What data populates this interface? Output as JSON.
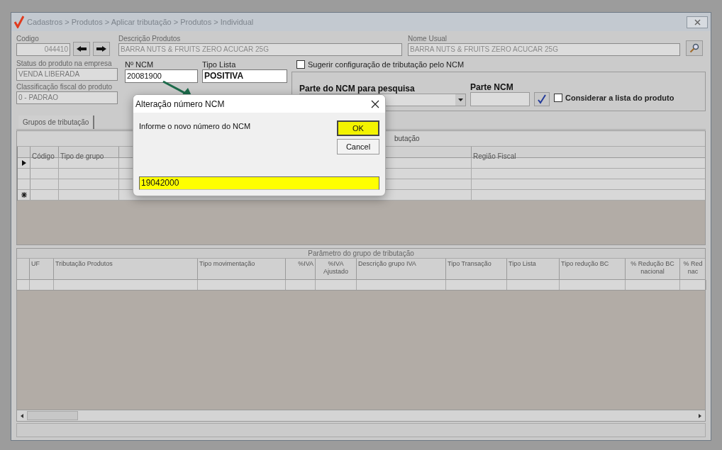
{
  "window": {
    "title": "Cadastros > Produtos > Aplicar tributação > Produtos > Individual"
  },
  "product": {
    "code_label": "Codigo",
    "code": "044410",
    "description_label": "Descrição  Produtos",
    "description": "BARRA NUTS & FRUITS ZERO ACUCAR 25G",
    "usual_name_label": "Nome Usual",
    "usual_name": "BARRA NUTS & FRUITS ZERO ACUCAR 25G",
    "status_label": "Status do produto na empresa",
    "status": "VENDA LIBERADA",
    "fiscal_label": "Classificação fiscal do produto",
    "fiscal": "0 - PADRAO",
    "ncm_label": "Nº NCM",
    "ncm": "20081900",
    "list_type_label": "Tipo Lista",
    "list_type": "POSITIVA"
  },
  "ncm_search": {
    "suggest": {
      "label": "Sugerir configuração de tributação pelo NCM",
      "checked": false
    },
    "part_label": "Parte do NCM para pesquisa",
    "part_ncm_label": "Parte NCM",
    "consider": {
      "label": "Considerar a lista do produto",
      "checked": false
    }
  },
  "tabs": [
    {
      "label": "Grupos de tributação",
      "selected": true
    }
  ],
  "groups_grid": {
    "caption": "butação",
    "columns": [
      "Código",
      "Tipo de grupo",
      "Região Fiscal"
    ],
    "rows": [
      {
        "kind": "current"
      },
      {
        "kind": "plain"
      },
      {
        "kind": "plain"
      },
      {
        "kind": "new"
      }
    ]
  },
  "params_grid": {
    "caption": "Parâmetro do grupo de tributação",
    "columns": [
      "UF",
      "Tributação Produtos",
      "Tipo movimentação",
      "%IVA",
      "%IVA Ajustado",
      "Descrição grupo IVA",
      "Tipo Transação",
      "Tipo Lista",
      "Tipo redução BC",
      "% Redução BC nacional",
      "% Red nac"
    ]
  },
  "dialog": {
    "title": "Alteração número NCM",
    "message": "Informe o novo número do NCM",
    "value": "19042000",
    "buttons": [
      {
        "label": "OK",
        "default": true
      },
      {
        "label": "Cancel",
        "default": false
      }
    ]
  }
}
